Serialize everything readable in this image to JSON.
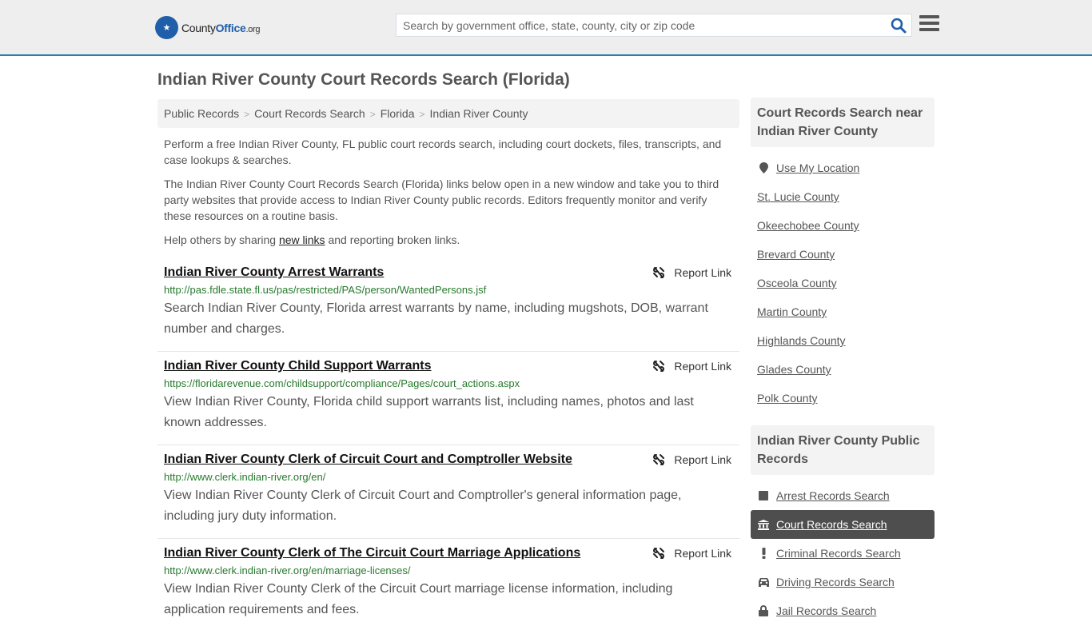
{
  "header": {
    "logo": {
      "county": "County",
      "office": "Office",
      "org": ".org"
    },
    "search_placeholder": "Search by government office, state, county, city or zip code",
    "search_icon": "search-icon",
    "menu_icon": "hamburger-menu-icon"
  },
  "page_title": "Indian River County Court Records Search (Florida)",
  "breadcrumb": [
    {
      "label": "Public Records"
    },
    {
      "label": "Court Records Search"
    },
    {
      "label": "Florida"
    },
    {
      "label": "Indian River County"
    }
  ],
  "intro": {
    "p1": "Perform a free Indian River County, FL public court records search, including court dockets, files, transcripts, and case lookups & searches.",
    "p2": "The Indian River County Court Records Search (Florida) links below open in a new window and take you to third party websites that provide access to Indian River County public records. Editors frequently monitor and verify these resources on a routine basis.",
    "p3_before": "Help others by sharing ",
    "p3_link": "new links",
    "p3_after": " and reporting broken links."
  },
  "report_label": "Report Link",
  "results": [
    {
      "title": "Indian River County Arrest Warrants",
      "url": "http://pas.fdle.state.fl.us/pas/restricted/PAS/person/WantedPersons.jsf",
      "description": "Search Indian River County, Florida arrest warrants by name, including mugshots, DOB, warrant number and charges."
    },
    {
      "title": "Indian River County Child Support Warrants",
      "url": "https://floridarevenue.com/childsupport/compliance/Pages/court_actions.aspx",
      "description": "View Indian River County, Florida child support warrants list, including names, photos and last known addresses."
    },
    {
      "title": "Indian River County Clerk of Circuit Court and Comptroller Website",
      "url": "http://www.clerk.indian-river.org/en/",
      "description": "View Indian River County Clerk of Circuit Court and Comptroller's general information page, including jury duty information."
    },
    {
      "title": "Indian River County Clerk of The Circuit Court Marriage Applications",
      "url": "http://www.clerk.indian-river.org/en/marriage-licenses/",
      "description": "View Indian River County Clerk of the Circuit Court marriage license information, including application requirements and fees."
    }
  ],
  "sidebar": {
    "nearby_heading": "Court Records Search near Indian River County",
    "use_location": "Use My Location",
    "nearby": [
      "St. Lucie County",
      "Okeechobee County",
      "Brevard County",
      "Osceola County",
      "Martin County",
      "Highlands County",
      "Glades County",
      "Polk County"
    ],
    "public_heading": "Indian River County Public Records",
    "public_records": [
      {
        "label": "Arrest Records Search",
        "icon": "square-icon",
        "active": false
      },
      {
        "label": "Court Records Search",
        "icon": "courthouse-icon",
        "active": true
      },
      {
        "label": "Criminal Records Search",
        "icon": "exclamation-icon",
        "active": false
      },
      {
        "label": "Driving Records Search",
        "icon": "car-icon",
        "active": false
      },
      {
        "label": "Jail Records Search",
        "icon": "lock-icon",
        "active": false
      }
    ]
  }
}
